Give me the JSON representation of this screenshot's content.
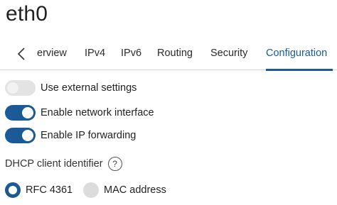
{
  "header": {
    "title": "eth0"
  },
  "tabs": [
    {
      "label": "erview"
    },
    {
      "label": "IPv4"
    },
    {
      "label": "IPv6"
    },
    {
      "label": "Routing"
    },
    {
      "label": "Security"
    },
    {
      "label": "Configuration",
      "active": true
    }
  ],
  "toggles": [
    {
      "label": "Use external settings",
      "state": "off"
    },
    {
      "label": "Enable network interface",
      "state": "on"
    },
    {
      "label": "Enable IP forwarding",
      "state": "on"
    }
  ],
  "dhcp": {
    "label": "DHCP client identifier",
    "help_glyph": "?",
    "options": [
      {
        "label": "RFC 4361",
        "selected": true
      },
      {
        "label": "MAC address",
        "selected": false
      }
    ]
  },
  "colors": {
    "accent": "#1a5a96",
    "toggle_off": "#e3e3e3",
    "radio_off": "#dcdcdc"
  },
  "icons": {
    "back": "chevron-left-icon",
    "help": "help-icon"
  }
}
